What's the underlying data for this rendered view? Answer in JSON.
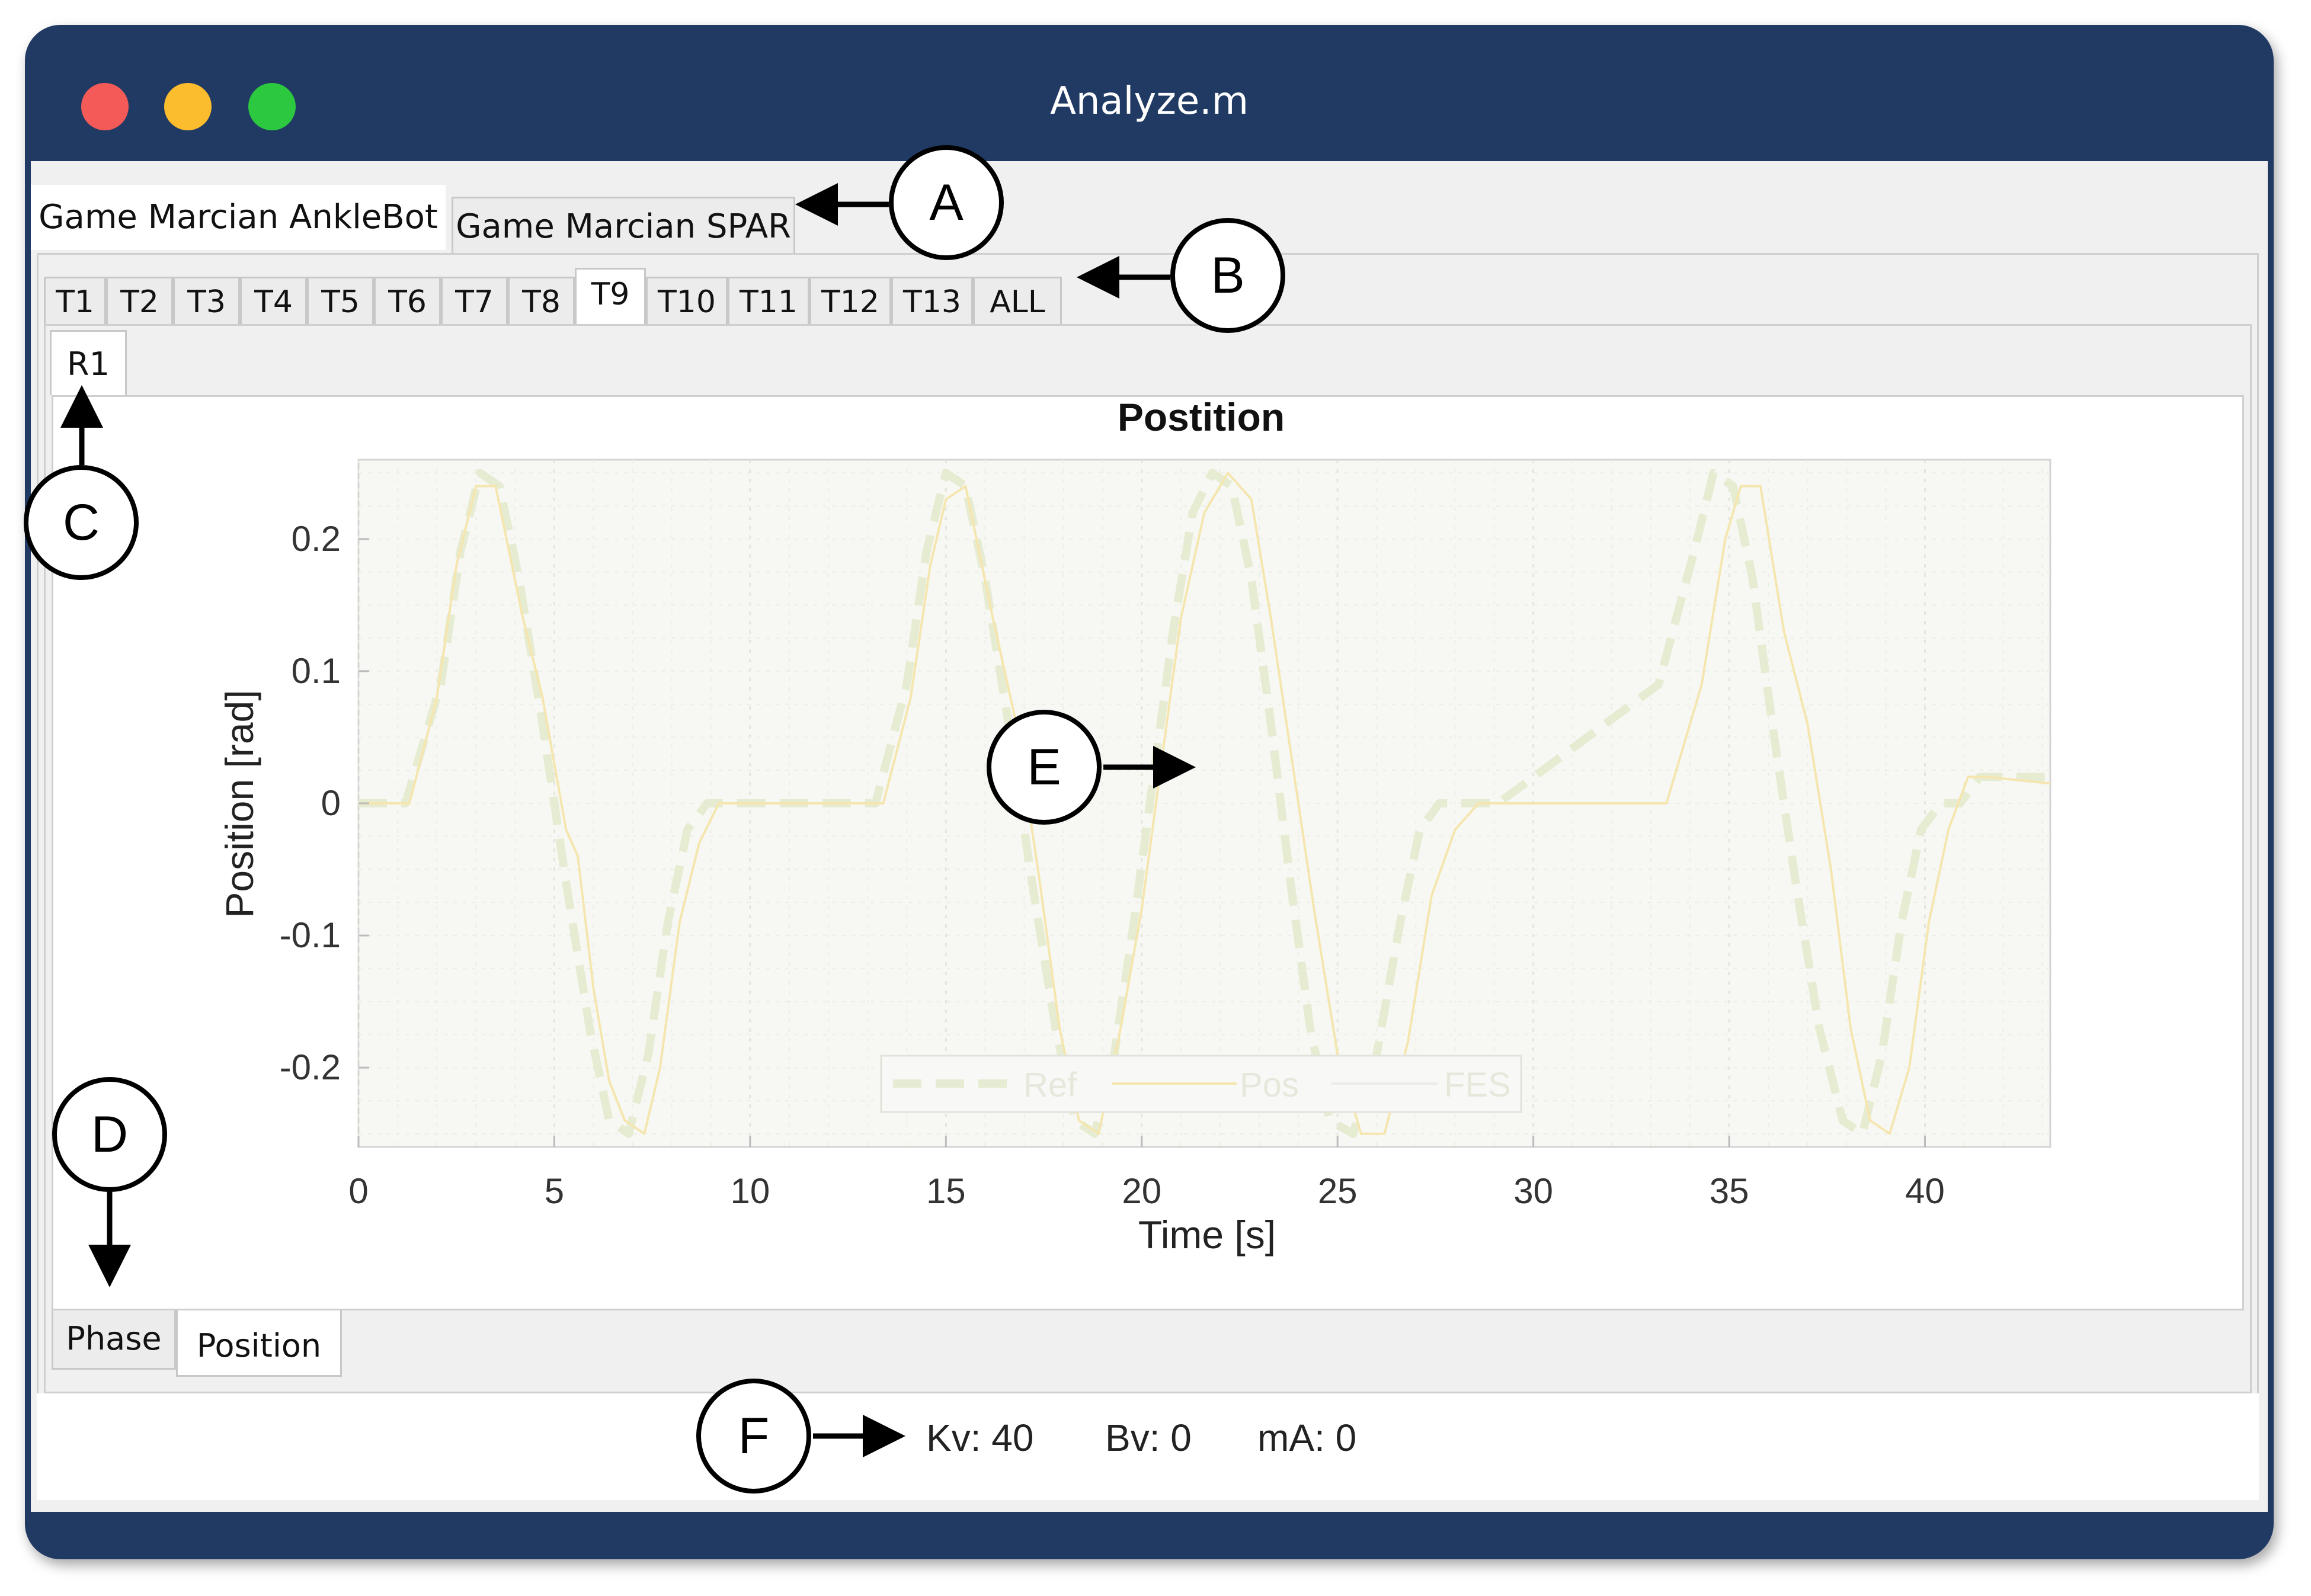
{
  "window": {
    "title": "Analyze.m"
  },
  "game_tabs": [
    {
      "label": "Game Marcian AnkleBot",
      "active": true
    },
    {
      "label": "Game Marcian SPAR",
      "active": false
    }
  ],
  "trial_tabs": [
    "T1",
    "T2",
    "T3",
    "T4",
    "T5",
    "T6",
    "T7",
    "T8",
    "T9",
    "T10",
    "T11",
    "T12",
    "T13",
    "ALL"
  ],
  "trial_active": "T9",
  "rep_tabs": [
    "R1"
  ],
  "view_tabs": [
    {
      "label": "Phase",
      "active": false
    },
    {
      "label": "Position",
      "active": true
    }
  ],
  "status": {
    "kv": "Kv: 40",
    "bv": "Bv: 0",
    "ma": "mA: 0"
  },
  "callouts": {
    "a": "A",
    "b": "B",
    "c": "C",
    "d": "D",
    "e": "E",
    "f": "F"
  },
  "colors": {
    "titlebar": "#203a63",
    "ref_line": "#e6ecd2",
    "pos_line": "#f5e6b0",
    "fes_line": "#f0f0ee"
  },
  "chart_data": {
    "type": "line",
    "title": "Postition",
    "xlabel": "Time [s]",
    "ylabel": "Position [rad]",
    "xlim": [
      0,
      43.2
    ],
    "ylim": [
      -0.26,
      0.26
    ],
    "xticks": [
      0,
      5,
      10,
      15,
      20,
      25,
      30,
      35,
      40
    ],
    "xtick_labels": [
      "0",
      "5",
      "10",
      "15",
      "20",
      "25",
      "30",
      "35",
      "40"
    ],
    "yticks": [
      0.2,
      0.1,
      0,
      -0.1,
      -0.2
    ],
    "ytick_labels": [
      "0.2",
      "0.1",
      "0",
      "-0.1",
      "-0.2"
    ],
    "grid": true,
    "legend_position": "bottom-center",
    "series": [
      {
        "name": "Ref",
        "x": [
          0,
          1.2,
          2.1,
          2.6,
          3.1,
          3.6,
          4.1,
          4.7,
          5.3,
          5.9,
          6.4,
          6.9,
          7.4,
          7.9,
          8.4,
          8.9,
          9.4,
          13.2,
          14.0,
          14.5,
          15.0,
          15.5,
          16.0,
          16.6,
          17.2,
          17.8,
          18.3,
          18.8,
          19.3,
          19.8,
          20.3,
          20.8,
          21.3,
          21.8,
          22.3,
          22.8,
          23.3,
          23.8,
          24.3,
          24.8,
          25.4,
          26.0,
          26.6,
          27.1,
          27.6,
          28.1,
          28.6,
          29.1,
          33.2,
          34.1,
          34.6,
          35.1,
          35.6,
          36.1,
          36.7,
          37.3,
          37.9,
          38.4,
          38.9,
          39.4,
          39.9,
          40.4,
          40.9,
          41.4,
          43.2
        ],
        "y": [
          0,
          0,
          0.09,
          0.19,
          0.25,
          0.24,
          0.17,
          0.06,
          -0.06,
          -0.17,
          -0.24,
          -0.25,
          -0.19,
          -0.09,
          -0.02,
          0,
          0,
          0,
          0.09,
          0.19,
          0.25,
          0.24,
          0.17,
          0.06,
          -0.06,
          -0.17,
          -0.24,
          -0.25,
          -0.19,
          -0.09,
          0.02,
          0.13,
          0.22,
          0.25,
          0.24,
          0.17,
          0.06,
          -0.06,
          -0.17,
          -0.24,
          -0.25,
          -0.19,
          -0.09,
          -0.02,
          0,
          0,
          0,
          0,
          0.09,
          0.19,
          0.25,
          0.24,
          0.17,
          0.06,
          -0.06,
          -0.17,
          -0.24,
          -0.25,
          -0.19,
          -0.09,
          -0.02,
          0,
          0,
          0.02,
          0.02
        ]
      },
      {
        "name": "Pos",
        "x": [
          0,
          1.3,
          2.0,
          2.5,
          3.0,
          3.5,
          4.2,
          4.7,
          5.3,
          5.6,
          6.0,
          6.4,
          6.8,
          7.3,
          7.7,
          8.2,
          8.7,
          9.2,
          13.4,
          14.1,
          14.6,
          15.0,
          15.5,
          16.2,
          16.8,
          17.4,
          17.9,
          18.4,
          18.9,
          19.4,
          20.0,
          20.5,
          21.0,
          21.6,
          22.2,
          22.8,
          23.3,
          23.8,
          24.4,
          25.0,
          25.6,
          26.2,
          26.8,
          27.4,
          28.0,
          28.6,
          29.3,
          33.4,
          34.3,
          34.9,
          35.3,
          35.8,
          36.4,
          37.0,
          37.6,
          38.1,
          38.6,
          39.1,
          39.6,
          40.1,
          40.6,
          41.1,
          41.6,
          43.2
        ],
        "y": [
          0,
          0,
          0.08,
          0.18,
          0.24,
          0.24,
          0.14,
          0.08,
          -0.02,
          -0.04,
          -0.14,
          -0.21,
          -0.24,
          -0.25,
          -0.2,
          -0.09,
          -0.03,
          0,
          0,
          0.08,
          0.18,
          0.23,
          0.24,
          0.14,
          0.06,
          -0.06,
          -0.17,
          -0.24,
          -0.25,
          -0.18,
          -0.08,
          0.03,
          0.14,
          0.22,
          0.25,
          0.23,
          0.14,
          0.04,
          -0.08,
          -0.19,
          -0.25,
          -0.25,
          -0.18,
          -0.07,
          -0.02,
          0,
          0,
          0,
          0.09,
          0.2,
          0.24,
          0.24,
          0.13,
          0.06,
          -0.05,
          -0.17,
          -0.24,
          -0.25,
          -0.2,
          -0.09,
          -0.02,
          0.02,
          0.02,
          0.015
        ]
      },
      {
        "name": "FES",
        "x": [],
        "y": []
      }
    ]
  }
}
